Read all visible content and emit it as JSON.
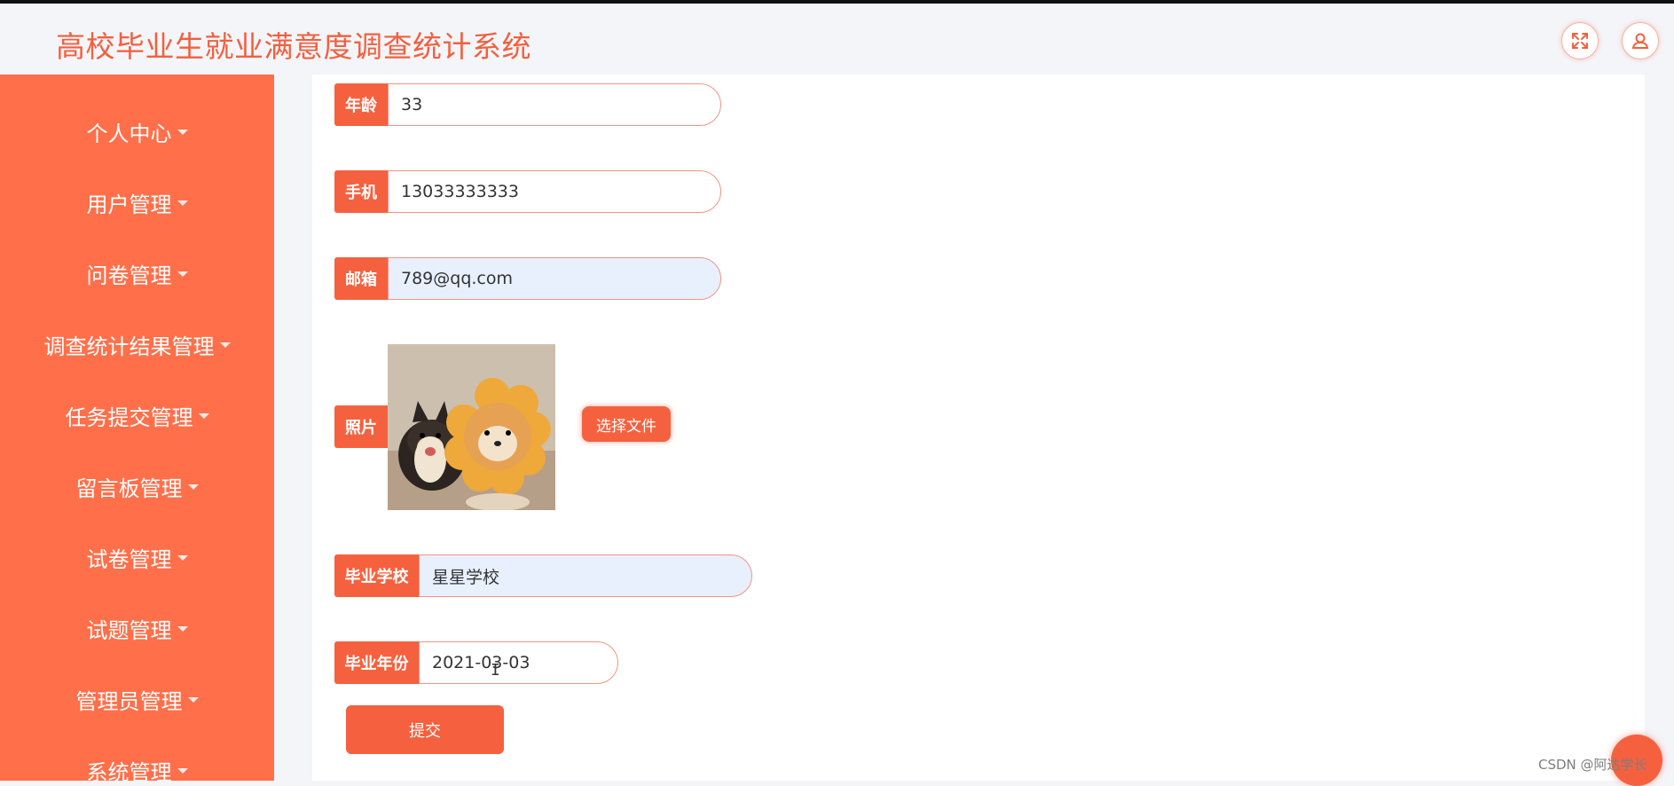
{
  "header": {
    "title": "高校毕业生就业满意度调查统计系统",
    "fullscreen_icon": "fullscreen-icon",
    "user_icon": "user-icon",
    "accent_color": "#f5613f"
  },
  "sidebar": {
    "background": "#ff6f4a",
    "items": [
      {
        "label": "个人中心"
      },
      {
        "label": "用户管理"
      },
      {
        "label": "问卷管理"
      },
      {
        "label": "调查统计结果管理"
      },
      {
        "label": "任务提交管理"
      },
      {
        "label": "留言板管理"
      },
      {
        "label": "试卷管理"
      },
      {
        "label": "试题管理"
      },
      {
        "label": "管理员管理"
      },
      {
        "label": "系统管理"
      }
    ]
  },
  "form": {
    "age": {
      "label": "年龄",
      "value": "33"
    },
    "phone": {
      "label": "手机",
      "value": "13033333333"
    },
    "email": {
      "label": "邮箱",
      "value": "789@qq.com"
    },
    "photo": {
      "label": "照片",
      "choose_label": "选择文件"
    },
    "school": {
      "label": "毕业学校",
      "value": "星星学校"
    },
    "grad_year": {
      "label": "毕业年份",
      "value": "2021-03-03"
    },
    "submit_label": "提交"
  },
  "watermark": "CSDN @阿达学长"
}
